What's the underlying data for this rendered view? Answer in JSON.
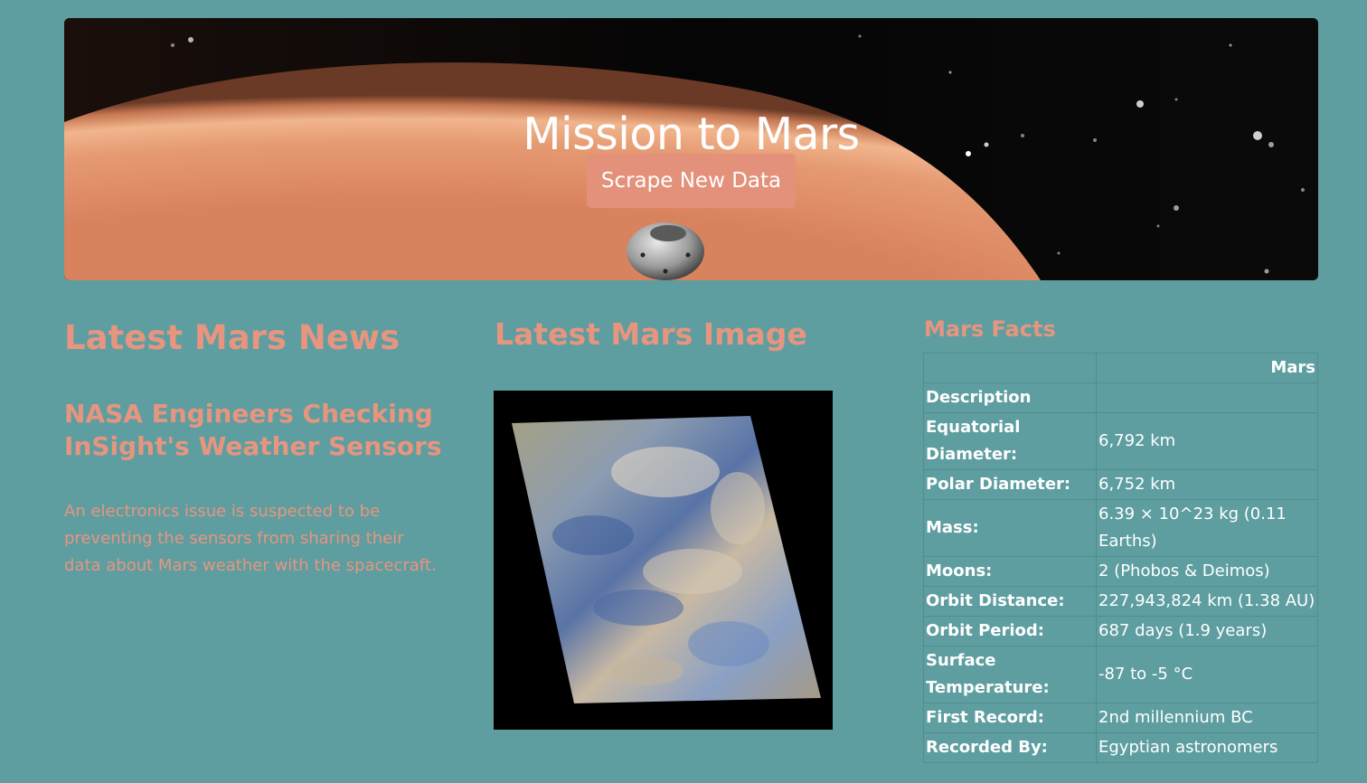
{
  "hero": {
    "title": "Mission to Mars",
    "button_label": "Scrape New Data"
  },
  "news": {
    "section_title": "Latest Mars News",
    "headline": "NASA Engineers Checking InSight's Weather Sensors",
    "teaser": "An electronics issue is suspected to be preventing the sensors from sharing their data about Mars weather with the spacecraft."
  },
  "image": {
    "section_title": "Latest Mars Image"
  },
  "facts": {
    "section_title": "Mars Facts",
    "column_header": "Mars",
    "rows": [
      {
        "label": "Description",
        "value": ""
      },
      {
        "label": "Equatorial Diameter:",
        "value": "6,792 km"
      },
      {
        "label": "Polar Diameter:",
        "value": "6,752 km"
      },
      {
        "label": "Mass:",
        "value": "6.39 × 10^23 kg (0.11 Earths)"
      },
      {
        "label": "Moons:",
        "value": "2 (Phobos & Deimos)"
      },
      {
        "label": "Orbit Distance:",
        "value": "227,943,824 km (1.38 AU)"
      },
      {
        "label": "Orbit Period:",
        "value": "687 days (1.9 years)"
      },
      {
        "label": "Surface Temperature:",
        "value": "-87 to -5 °C"
      },
      {
        "label": "First Record:",
        "value": "2nd millennium BC"
      },
      {
        "label": "Recorded By:",
        "value": "Egyptian astronomers"
      }
    ]
  },
  "colors": {
    "background": "#5e9ea0",
    "accent": "#e8957f",
    "button": "#e3917a"
  }
}
